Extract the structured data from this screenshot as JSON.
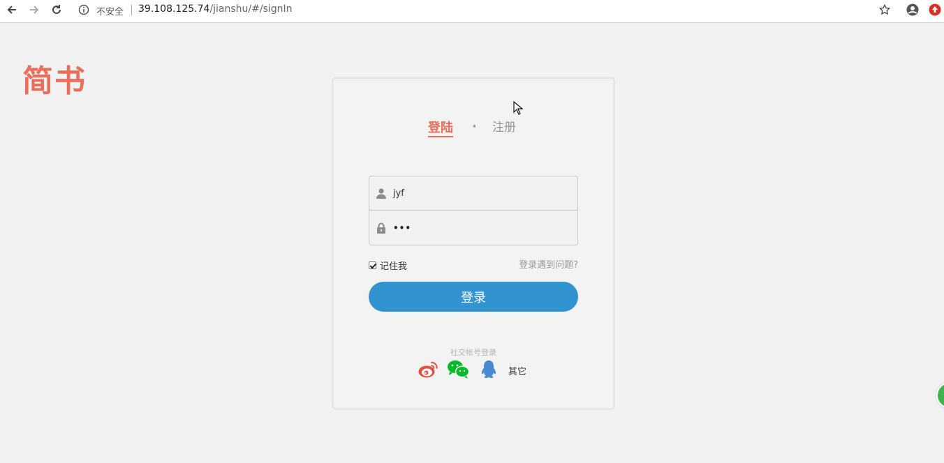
{
  "browser": {
    "insecure_label": "不安全",
    "url_host": "39.108.125.74",
    "url_path": "/jianshu/#/signIn"
  },
  "logo": {
    "text": "简书"
  },
  "tabs": {
    "login": "登陆",
    "separator": "·",
    "register": "注册"
  },
  "form": {
    "username_value": "jyf",
    "password_mask": "•••",
    "remember_label": "记住我",
    "remember_checked": true,
    "trouble_link": "登录遇到问题?",
    "submit_label": "登录"
  },
  "social": {
    "title": "社交帐号登录",
    "other_label": "其它",
    "icons": [
      "weibo-icon",
      "wechat-icon",
      "qq-icon"
    ]
  },
  "colors": {
    "brand": "#ea6f5a",
    "primary": "#3194d0",
    "wechat": "#00bb29",
    "qq": "#498ad5",
    "weibo": "#e05244"
  }
}
